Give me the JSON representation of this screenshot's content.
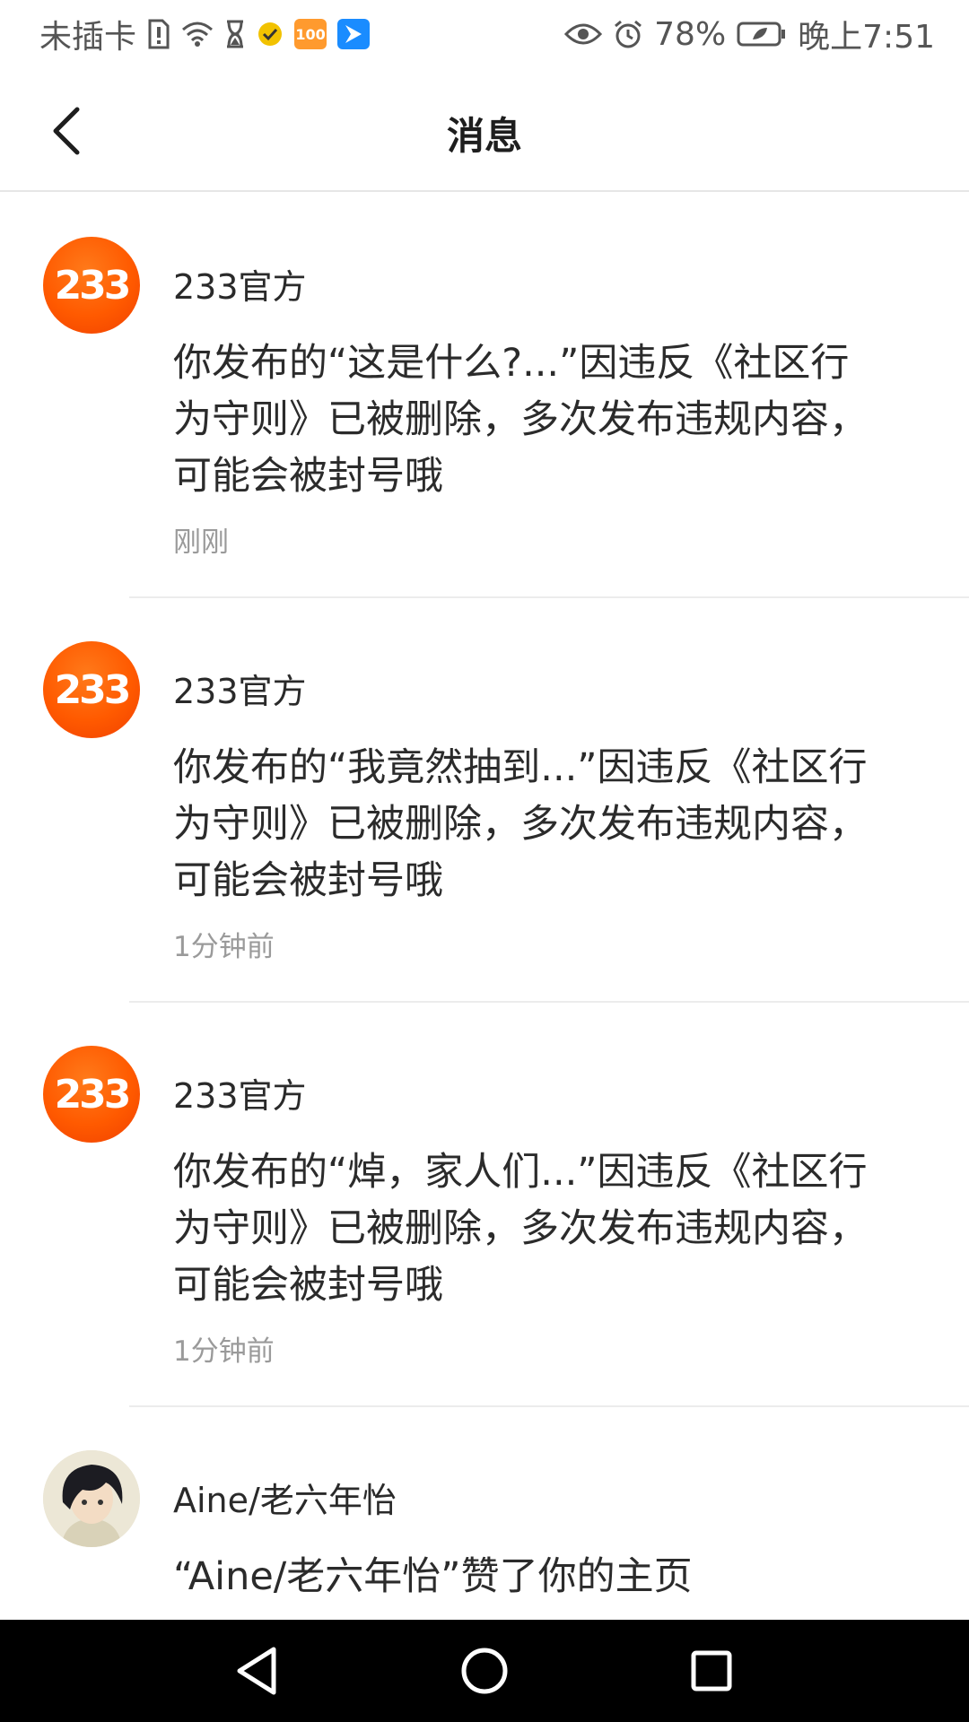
{
  "status_bar": {
    "carrier": "未插卡",
    "battery": "78%",
    "time": "晚上7:51",
    "badge_100": "100",
    "colors": {
      "badge_yellow": "#f2c200",
      "badge_100": "#ff9a2e",
      "badge_blue": "#1a8cff"
    }
  },
  "header": {
    "title": "消息"
  },
  "messages": [
    {
      "avatar_text": "233",
      "sender": "233官方",
      "content": "你发布的“这是什么?...”因违反《社区行为守则》已被删除，多次发布违规内容，可能会被封号哦",
      "time": "刚刚"
    },
    {
      "avatar_text": "233",
      "sender": "233官方",
      "content": "你发布的“我竟然抽到...”因违反《社区行为守则》已被删除，多次发布违规内容，可能会被封号哦",
      "time": "1分钟前"
    },
    {
      "avatar_text": "233",
      "sender": "233官方",
      "content": "你发布的“焯，家人们...”因违反《社区行为守则》已被删除，多次发布违规内容，可能会被封号哦",
      "time": "1分钟前"
    },
    {
      "sender": "Aine/老六年怡",
      "content": "“Aine/老六年怡”赞了你的主页"
    }
  ],
  "colors": {
    "brand_orange": "#ff5a00",
    "divider": "#ececec",
    "time_gray": "#9a9a9a"
  }
}
